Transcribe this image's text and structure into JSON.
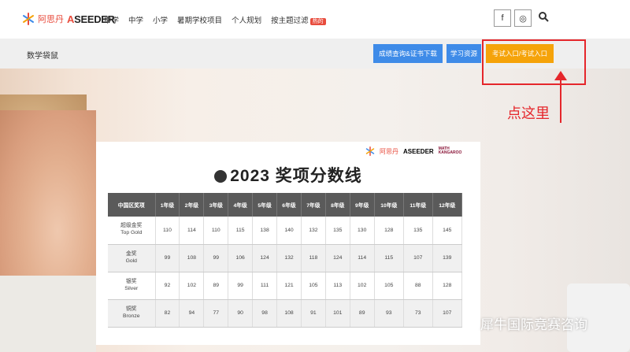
{
  "nav": {
    "logo_cn": "阿思丹",
    "logo_brand_a": "A",
    "logo_brand_rest": "SEEDER",
    "items": [
      "中学",
      "中学",
      "小学",
      "暑期学校项目",
      "个人规划",
      "按主题过滤"
    ],
    "hot_badge": "热的",
    "social": [
      "f",
      "◎"
    ]
  },
  "subbar": {
    "title": "数学袋鼠",
    "buttons": [
      "成绩查询&证书下载",
      "学习资源",
      "考试入口/考试入口"
    ]
  },
  "annotation": {
    "hint": "点这里"
  },
  "card": {
    "logo_cn": "阿思丹",
    "logo_brand": "ASEEDER",
    "logo_mk": "MATH KANGAROO",
    "title": "2023 奖项分数线",
    "headers": [
      "中国区奖项",
      "1年级",
      "2年级",
      "3年级",
      "4年级",
      "5年级",
      "6年级",
      "7年级",
      "8年级",
      "9年级",
      "10年级",
      "11年级",
      "12年级"
    ],
    "rows": [
      {
        "cn": "超级金奖",
        "en": "Top Gold",
        "values": [
          "110",
          "114",
          "110",
          "115",
          "138",
          "140",
          "132",
          "135",
          "130",
          "128",
          "135",
          "145"
        ]
      },
      {
        "cn": "金奖",
        "en": "Gold",
        "values": [
          "99",
          "108",
          "99",
          "106",
          "124",
          "132",
          "118",
          "124",
          "114",
          "115",
          "107",
          "139"
        ]
      },
      {
        "cn": "银奖",
        "en": "Silver",
        "values": [
          "92",
          "102",
          "89",
          "99",
          "111",
          "121",
          "105",
          "113",
          "102",
          "105",
          "88",
          "128"
        ]
      },
      {
        "cn": "铜奖",
        "en": "Bronze",
        "values": [
          "82",
          "94",
          "77",
          "90",
          "98",
          "108",
          "91",
          "101",
          "89",
          "93",
          "73",
          "107"
        ]
      }
    ]
  },
  "watermark": "犀牛国际竞赛咨询",
  "colors": {
    "accent_red": "#e5262b",
    "blue_button": "#3e8be8",
    "orange_button": "#f5a30a"
  }
}
